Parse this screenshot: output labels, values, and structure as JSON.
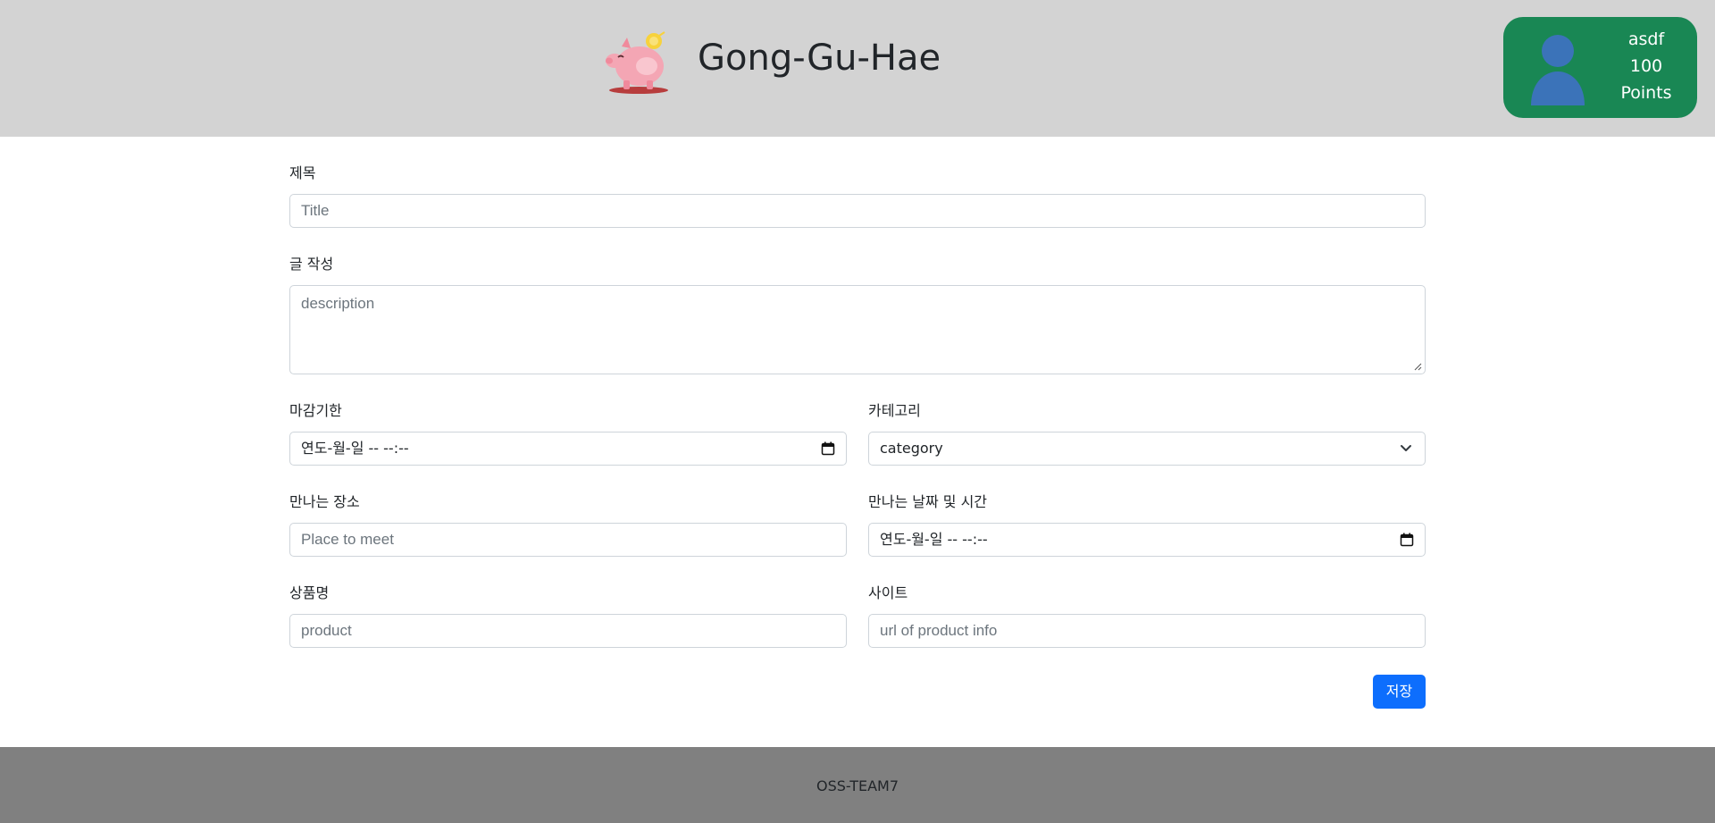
{
  "header": {
    "brand": "Gong-Gu-Hae",
    "logo_icon": "piggy-bank-icon",
    "background": "#d3d3d3"
  },
  "profile": {
    "username": "asdf",
    "points_value": "100",
    "points_label": "Points",
    "avatar_icon": "user-avatar-icon",
    "background": "#198754"
  },
  "form": {
    "title": {
      "label": "제목",
      "placeholder": "Title"
    },
    "description": {
      "label": "글 작성",
      "placeholder": "description"
    },
    "deadline": {
      "label": "마감기한",
      "value": "연도-월-일 -- --:--"
    },
    "category": {
      "label": "카테고리",
      "selected": "category"
    },
    "place": {
      "label": "만나는 장소",
      "placeholder": "Place to meet"
    },
    "meet_datetime": {
      "label": "만나는 날짜 및 시간",
      "value": "연도-월-일 -- --:--"
    },
    "product": {
      "label": "상품명",
      "placeholder": "product"
    },
    "site": {
      "label": "사이트",
      "placeholder": "url of product info"
    },
    "save_label": "저장"
  },
  "footer": {
    "text": "OSS-TEAM7",
    "background": "#808080"
  },
  "colors": {
    "primary_button": "#0d6efd",
    "input_border": "#ced4da"
  }
}
